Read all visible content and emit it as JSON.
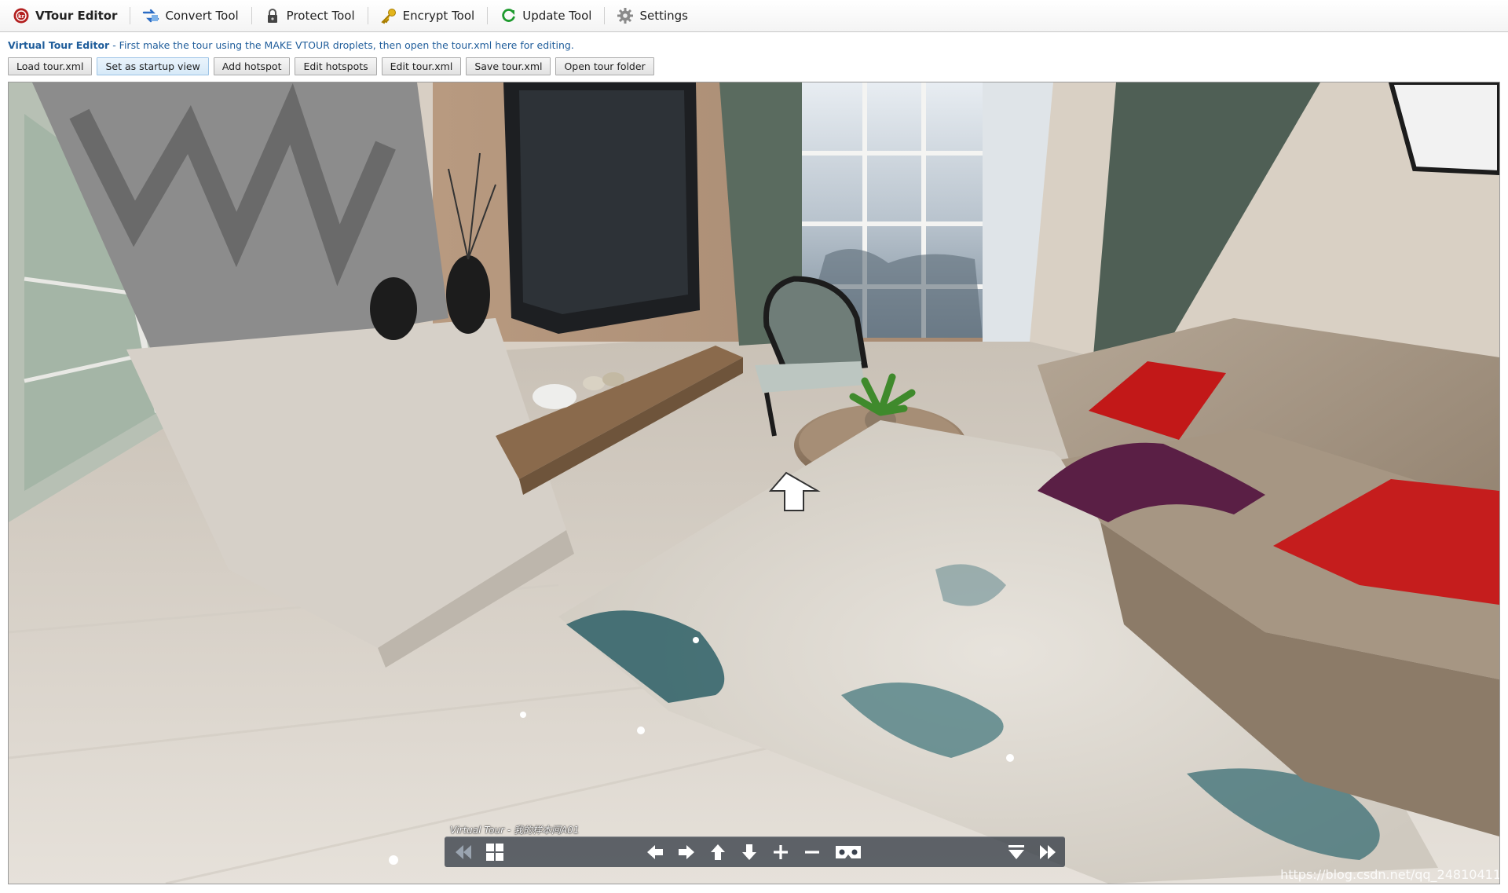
{
  "app": {
    "tabs": [
      {
        "label": "VTour Editor",
        "icon": "vtour-editor-icon",
        "active": true
      },
      {
        "label": "Convert Tool",
        "icon": "convert-icon"
      },
      {
        "label": "Protect Tool",
        "icon": "lock-icon"
      },
      {
        "label": "Encrypt Tool",
        "icon": "key-icon"
      },
      {
        "label": "Update Tool",
        "icon": "refresh-icon"
      },
      {
        "label": "Settings",
        "icon": "gear-icon"
      }
    ]
  },
  "info": {
    "title": "Virtual Tour Editor",
    "text": " - First make the tour using the MAKE VTOUR droplets, then open the tour.xml here for editing."
  },
  "buttons": {
    "load": "Load tour.xml",
    "startup": "Set as startup view",
    "add_hotspot": "Add hotspot",
    "edit_hotspots": "Edit hotspots",
    "edit_xml": "Edit tour.xml",
    "save_xml": "Save tour.xml",
    "open_folder": "Open tour folder"
  },
  "viewer": {
    "scene_title": "Virtual Tour - 我的样本间A01",
    "watermark": "https://blog.csdn.net/qq_24810411",
    "controls": [
      "prev-scene-icon",
      "thumbnails-icon",
      "arrow-left-icon",
      "arrow-right-icon",
      "arrow-up-icon",
      "arrow-down-icon",
      "zoom-in-icon",
      "zoom-out-icon",
      "vr-goggles-icon",
      "hide-bar-icon",
      "next-scene-icon"
    ]
  },
  "colors": {
    "accent_text": "#1f5d9b",
    "control_bar": "#28303c"
  }
}
